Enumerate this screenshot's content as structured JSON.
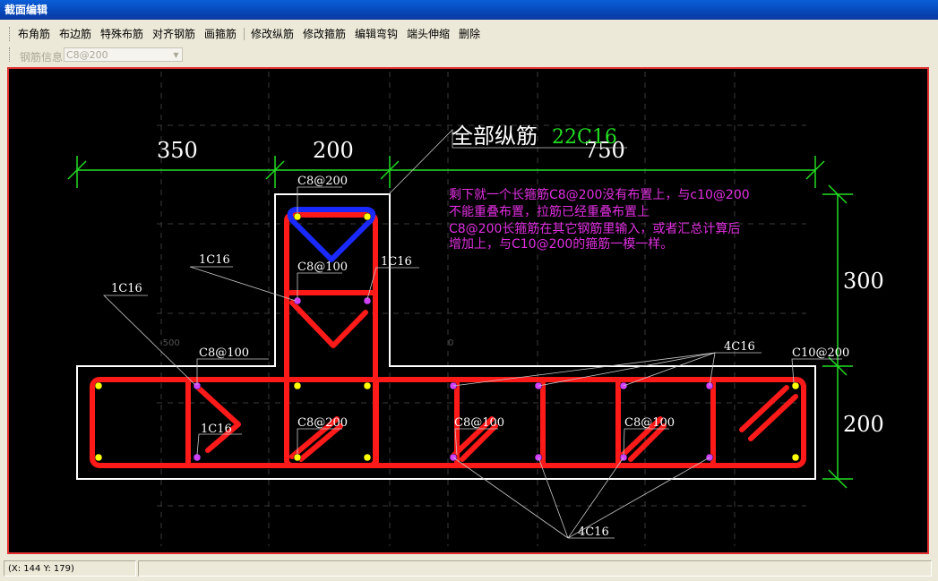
{
  "window": {
    "title": "截面编辑"
  },
  "toolbar": {
    "items": [
      "布角筋",
      "布边筋",
      "特殊布筋",
      "对齐钢筋",
      "画箍筋",
      "修改纵筋",
      "修改箍筋",
      "编辑弯钩",
      "端头伸缩",
      "删除"
    ]
  },
  "rebar_info": {
    "label": "钢筋信息",
    "value": "C8@200"
  },
  "drawing": {
    "dims": {
      "d350": "350",
      "d200_top": "200",
      "d750": "750",
      "d300": "300",
      "d200_side": "200"
    },
    "total_label": "全部纵筋",
    "total_value": "22C16",
    "note_lines": [
      "剩下就一个长箍筋C8@200没有布置上，与c10@200",
      "不能重叠布置，拉筋已经重叠布置上",
      "C8@200长箍筋在其它钢筋里输入，或者汇总计算后",
      "增加上，与C10@200的箍筋一模一样。"
    ],
    "labels": {
      "c8_200_top": "C8@200",
      "c8_100_web": "C8@100",
      "one_c16_a": "1C16",
      "one_c16_b": "1C16",
      "one_c16_c": "1C16",
      "one_c16_d": "1C16",
      "c8_100_left": "C8@100",
      "c8_200_mid": "C8@200",
      "c8_100_mid": "C8@100",
      "c8_100_right": "C8@100",
      "four_c16_top": "4C16",
      "four_c16_bottom": "4C16",
      "c10_200": "C10@200",
      "coord_minus500": "-500",
      "coord_zero": "0"
    },
    "colors": {
      "stirrup": "#ff1a1a",
      "top_stirrup": "#1a2aff",
      "dimension": "#22dd22",
      "note": "#e030e0",
      "outline": "#ffffff"
    }
  },
  "status": {
    "coords": "(X: 144 Y: 179)"
  }
}
